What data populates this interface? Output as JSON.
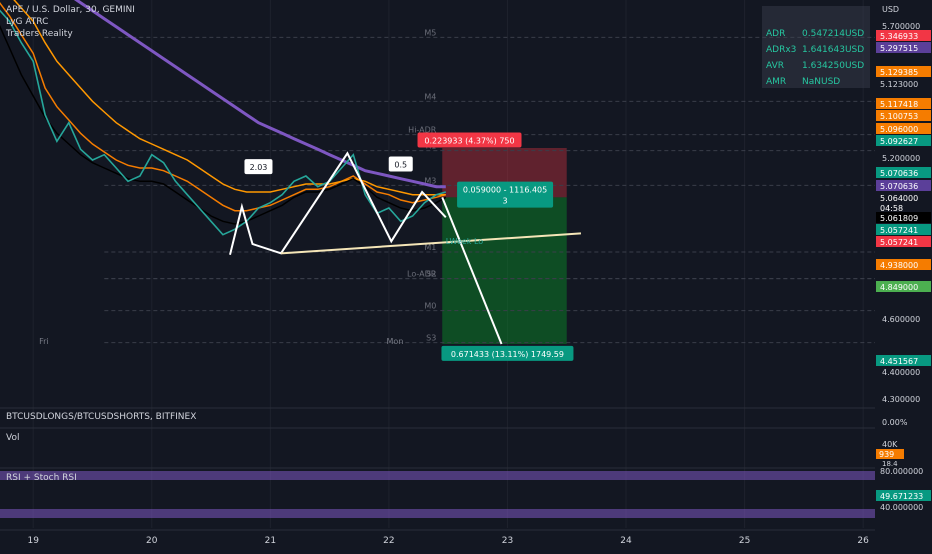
{
  "chart_data": {
    "type": "line",
    "header": {
      "symbol_line": "APE / U.S. Dollar, 30, GEMINI",
      "indicator_1": "LyG ATRC",
      "indicator_2": "Traders Reality"
    },
    "price_axis": {
      "currency": "USD",
      "ticks": [
        "5.700000",
        "5.200000",
        "4.600000",
        "4.400000",
        "4.300000"
      ]
    },
    "price_tags": [
      {
        "text": "5.346933",
        "bg": "#f23645",
        "fg": "#ffffff"
      },
      {
        "text": "5.297515",
        "bg": "#5b3f99",
        "fg": "#ffffff"
      },
      {
        "text": "5.129385",
        "bg": "#f57c00",
        "fg": "#ffffff"
      },
      {
        "text": "5.123000",
        "bg": "#131722",
        "fg": "#d1d4dc"
      },
      {
        "text": "5.117418",
        "bg": "#f57c00",
        "fg": "#ffffff"
      },
      {
        "text": "5.100753",
        "bg": "#f57c00",
        "fg": "#ffffff"
      },
      {
        "text": "5.096000",
        "bg": "#f57c00",
        "fg": "#ffffff"
      },
      {
        "text": "5.092627",
        "bg": "#089981",
        "fg": "#ffffff"
      },
      {
        "text": "5.070636",
        "bg": "#089981",
        "fg": "#ffffff"
      },
      {
        "text": "5.070636",
        "bg": "#5b3f99",
        "fg": "#ffffff"
      },
      {
        "text": "5.064000",
        "bg": "#131722",
        "fg": "#ffffff"
      },
      {
        "text": "04:58",
        "bg": "#131722",
        "fg": "#ffffff"
      },
      {
        "text": "5.061809",
        "bg": "#000000",
        "fg": "#ffffff"
      },
      {
        "text": "5.057241",
        "bg": "#089981",
        "fg": "#ffffff"
      },
      {
        "text": "5.057241",
        "bg": "#f23645",
        "fg": "#ffffff"
      },
      {
        "text": "4.938000",
        "bg": "#f57c00",
        "fg": "#ffffff"
      },
      {
        "text": "4.849000",
        "bg": "#4caf50",
        "fg": "#ffffff"
      },
      {
        "text": "4.451567",
        "bg": "#089981",
        "fg": "#ffffff"
      }
    ],
    "stats_table": [
      {
        "label": "ADR",
        "value": "0.547214USD"
      },
      {
        "label": "ADRx3",
        "value": "1.641643USD"
      },
      {
        "label": "AVR",
        "value": "1.634250USD"
      },
      {
        "label": "AMR",
        "value": "NaNUSD"
      }
    ],
    "levels": [
      {
        "name": "M5",
        "price": 5.64
      },
      {
        "name": "M4",
        "price": 5.4
      },
      {
        "name": "Hi-ADR",
        "price": 5.275
      },
      {
        "name": "R1",
        "price": 5.215
      },
      {
        "name": "M3",
        "price": 5.085
      },
      {
        "name": "M1",
        "price": 4.835
      },
      {
        "name": "S2",
        "price": 4.735
      },
      {
        "name": "Lo-ADR",
        "price": 4.735
      },
      {
        "name": "M0",
        "price": 4.615
      },
      {
        "name": "S3",
        "price": 4.495
      }
    ],
    "annotations": {
      "fib_a": "2.03",
      "fib_b": "0.5",
      "stop_label": "0.223933 (4.37%) 750",
      "entry_label_1": "0.059000 - 1116.405",
      "entry_label_2": "3",
      "target_label": "0.671433 (13.11%) 1749.59",
      "week_low": "LWeek Lo",
      "day_labels": [
        "Fri",
        "Mon"
      ]
    },
    "projection": {
      "entry": {
        "x": 22.45,
        "price": 5.04
      },
      "target": {
        "x": 22.95,
        "price": 4.49
      },
      "stop": 5.225,
      "target_zone": 4.49,
      "zone_x": [
        22.45,
        23.5
      ]
    },
    "pattern_points": [
      {
        "x": 20.66,
        "price": 4.825
      },
      {
        "x": 20.76,
        "price": 5.005
      },
      {
        "x": 20.85,
        "price": 4.865
      },
      {
        "x": 21.09,
        "price": 4.83
      },
      {
        "x": 21.65,
        "price": 5.205
      },
      {
        "x": 22.02,
        "price": 4.875
      },
      {
        "x": 22.28,
        "price": 5.06
      },
      {
        "x": 22.48,
        "price": 4.965
      }
    ],
    "trend_line": [
      {
        "x": 21.09,
        "price": 4.83
      },
      {
        "x": 23.62,
        "price": 4.905
      }
    ],
    "price_series": {
      "x": [
        18.7,
        18.8,
        18.9,
        19.0,
        19.1,
        19.2,
        19.3,
        19.4,
        19.5,
        19.6,
        19.7,
        19.8,
        19.9,
        20.0,
        20.1,
        20.2,
        20.3,
        20.4,
        20.5,
        20.6,
        20.7,
        20.8,
        20.9,
        21.0,
        21.1,
        21.2,
        21.3,
        21.4,
        21.5,
        21.6,
        21.7,
        21.8,
        21.9,
        22.0,
        22.1,
        22.2,
        22.3,
        22.4,
        22.48
      ],
      "y": [
        5.75,
        5.7,
        5.62,
        5.55,
        5.35,
        5.25,
        5.32,
        5.22,
        5.18,
        5.2,
        5.15,
        5.1,
        5.12,
        5.2,
        5.17,
        5.1,
        5.05,
        5.0,
        4.95,
        4.9,
        4.92,
        4.95,
        5.0,
        5.02,
        5.05,
        5.1,
        5.12,
        5.08,
        5.1,
        5.15,
        5.2,
        5.05,
        4.98,
        5.0,
        4.95,
        4.97,
        5.02,
        5.05,
        5.06
      ]
    },
    "ema_series": [
      {
        "name": "",
        "color": "#f57c00",
        "y": [
          5.78,
          5.72,
          5.65,
          5.58,
          5.45,
          5.38,
          5.33,
          5.28,
          5.24,
          5.21,
          5.18,
          5.16,
          5.15,
          5.15,
          5.14,
          5.12,
          5.1,
          5.07,
          5.04,
          5.01,
          4.99,
          4.99,
          5.0,
          5.01,
          5.03,
          5.05,
          5.07,
          5.07,
          5.08,
          5.1,
          5.12,
          5.09,
          5.06,
          5.05,
          5.03,
          5.02,
          5.03,
          5.04,
          5.05
        ]
      },
      {
        "name": "",
        "color": "#ff9800",
        "y": [
          5.85,
          5.8,
          5.75,
          5.7,
          5.62,
          5.55,
          5.5,
          5.45,
          5.4,
          5.36,
          5.32,
          5.29,
          5.26,
          5.24,
          5.22,
          5.2,
          5.18,
          5.15,
          5.12,
          5.09,
          5.07,
          5.06,
          5.06,
          5.06,
          5.07,
          5.08,
          5.09,
          5.09,
          5.09,
          5.1,
          5.11,
          5.1,
          5.08,
          5.07,
          5.06,
          5.05,
          5.05,
          5.05,
          5.05
        ]
      },
      {
        "name": "",
        "color": "#7e57c2",
        "y": [
          5.95,
          5.93,
          5.91,
          5.89,
          5.86,
          5.83,
          5.8,
          5.77,
          5.74,
          5.71,
          5.68,
          5.65,
          5.62,
          5.59,
          5.56,
          5.53,
          5.5,
          5.47,
          5.44,
          5.41,
          5.38,
          5.35,
          5.32,
          5.3,
          5.28,
          5.26,
          5.24,
          5.22,
          5.2,
          5.18,
          5.16,
          5.14,
          5.13,
          5.12,
          5.11,
          5.1,
          5.09,
          5.08,
          5.08
        ]
      },
      {
        "name": "",
        "color": "#000000",
        "y": [
          5.7,
          5.6,
          5.5,
          5.42,
          5.34,
          5.28,
          5.24,
          5.2,
          5.17,
          5.15,
          5.13,
          5.11,
          5.1,
          5.1,
          5.09,
          5.06,
          5.03,
          5.0,
          4.97,
          4.95,
          4.94,
          4.95,
          4.97,
          4.99,
          5.01,
          5.04,
          5.06,
          5.06,
          5.07,
          5.09,
          5.11,
          5.08,
          5.04,
          5.02,
          5.0,
          4.99,
          5.0,
          5.02,
          5.04
        ]
      }
    ],
    "x_axis": {
      "ticks": [
        {
          "x": 19,
          "label": "19"
        },
        {
          "x": 20,
          "label": "20"
        },
        {
          "x": 21,
          "label": "21"
        },
        {
          "x": 22,
          "label": "22"
        },
        {
          "x": 23,
          "label": "23"
        },
        {
          "x": 24,
          "label": "24"
        },
        {
          "x": 25,
          "label": "25"
        },
        {
          "x": 26,
          "label": "26"
        }
      ],
      "range": [
        18.72,
        26.1
      ]
    },
    "ylim": [
      4.28,
      5.78
    ],
    "sub_panes": {
      "longs_shorts": {
        "title": "BTCUSDLONGS/BTCUSDSHORTS, BITFINEX",
        "value": "0.00%"
      },
      "volume": {
        "title": "Vol",
        "axis": "40K",
        "tag_1": "939",
        "tag_2": "18.4"
      },
      "rsi": {
        "title": "RSI + Stoch RSI",
        "upper": "80.000000",
        "value": "49.671233",
        "lower": "40.000000"
      }
    }
  }
}
